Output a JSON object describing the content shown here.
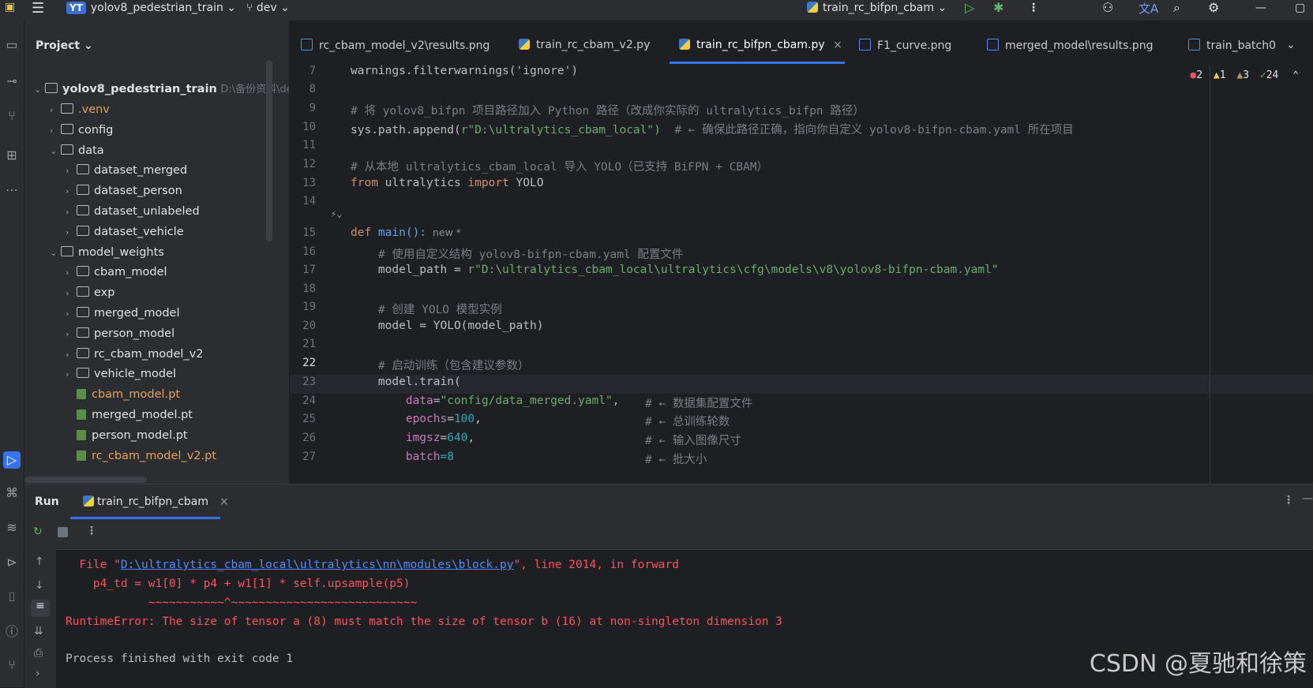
{
  "titlebar": {
    "project_badge": "YT",
    "project_name": "yolov8_pedestrian_train",
    "branch": "dev",
    "run_config": "train_rc_bifpn_cbam"
  },
  "project_panel": {
    "title": "Project",
    "root": "yolov8_pedestrian_train",
    "root_path": "D:\\备份资料\\dev",
    "items": [
      {
        "label": ".venv",
        "type": "folder",
        "indent": 1,
        "expanded": false
      },
      {
        "label": "config",
        "type": "folder",
        "indent": 1,
        "expanded": false
      },
      {
        "label": "data",
        "type": "folder",
        "indent": 1,
        "expanded": true
      },
      {
        "label": "dataset_merged",
        "type": "folder",
        "indent": 2,
        "expanded": false
      },
      {
        "label": "dataset_person",
        "type": "folder",
        "indent": 2,
        "expanded": false
      },
      {
        "label": "dataset_unlabeled",
        "type": "folder",
        "indent": 2,
        "expanded": false
      },
      {
        "label": "dataset_vehicle",
        "type": "folder",
        "indent": 2,
        "expanded": false
      },
      {
        "label": "model_weights",
        "type": "folder",
        "indent": 1,
        "expanded": true
      },
      {
        "label": "cbam_model",
        "type": "folder",
        "indent": 2,
        "expanded": false
      },
      {
        "label": "exp",
        "type": "folder",
        "indent": 2,
        "expanded": false
      },
      {
        "label": "merged_model",
        "type": "folder",
        "indent": 2,
        "expanded": false
      },
      {
        "label": "person_model",
        "type": "folder",
        "indent": 2,
        "expanded": false
      },
      {
        "label": "rc_cbam_model_v2",
        "type": "folder",
        "indent": 2,
        "expanded": false
      },
      {
        "label": "vehicle_model",
        "type": "folder",
        "indent": 2,
        "expanded": false
      },
      {
        "label": "cbam_model.pt",
        "type": "file",
        "indent": 2,
        "status": "orange"
      },
      {
        "label": "merged_model.pt",
        "type": "file",
        "indent": 2,
        "status": "normal"
      },
      {
        "label": "person_model.pt",
        "type": "file",
        "indent": 2,
        "status": "normal"
      },
      {
        "label": "rc_cbam_model_v2.pt",
        "type": "file",
        "indent": 2,
        "status": "orange"
      }
    ]
  },
  "tabs": [
    {
      "label": "rc_cbam_model_v2\\results.png",
      "kind": "image"
    },
    {
      "label": "train_rc_cbam_v2.py",
      "kind": "python"
    },
    {
      "label": "train_rc_bifpn_cbam.py",
      "kind": "python",
      "active": true
    },
    {
      "label": "F1_curve.png",
      "kind": "image"
    },
    {
      "label": "merged_model\\results.png",
      "kind": "image"
    },
    {
      "label": "train_batch0",
      "kind": "image"
    }
  ],
  "inspections": {
    "errors": "2",
    "warnings": "1",
    "weak_warnings": "3",
    "ok": "24"
  },
  "editor": {
    "lines": [
      "7",
      "8",
      "9",
      "10",
      "11",
      "12",
      "13",
      "14",
      "15",
      "16",
      "17",
      "18",
      "19",
      "20",
      "21",
      "22",
      "23",
      "24",
      "25",
      "26",
      "27"
    ],
    "code_7": "warnings.filterwarnings('ignore')",
    "c9": "# 将 yolov8_bifpn 项目路径加入 Python 路径（改成你实际的 ultralytics_bifpn 路径）",
    "c10a": "sys.path.append(",
    "c10b": "r\"D:\\ultralytics_cbam_local\")",
    "c10c": "  # ← 确保此路径正确，指向你自定义 yolov8-bifpn-cbam.yaml 所在项目",
    "c12": "# 从本地 ultralytics_cbam_local 导入 YOLO（已支持 BiFPN + CBAM）",
    "c13a": "from",
    "c13b": " ultralytics ",
    "c13c": "import",
    "c13d": " YOLO",
    "c15a": "def",
    "c15b": " main():",
    "c15c": "  new *",
    "c16": "    # 使用自定义结构 yolov8-bifpn-cbam.yaml 配置文件",
    "c17a": "    model_path = ",
    "c17b": "r\"D:\\ultralytics_cbam_local\\ultralytics\\cfg\\models\\v8\\yolov8-bifpn-cbam.yaml\"",
    "c19": "    # 创建 YOLO 模型实例",
    "c20": "    model = YOLO(model_path)",
    "c22": "    # 启动训练（包含建议参数）",
    "c23": "    model.train(",
    "c24a": "        data",
    "c24b": "=",
    "c24c": "\"config/data_merged.yaml\"",
    "c24d": ",",
    "c24e": "# ← 数据集配置文件",
    "c25a": "        epochs",
    "c25b": "=",
    "c25c": "100",
    "c25d": ",",
    "c25e": "# ← 总训练轮数",
    "c26a": "        imgsz",
    "c26b": "=",
    "c26c": "640",
    "c26d": ",",
    "c26e": "# ← 输入图像尺寸",
    "c27a": "        batch",
    "c27b": "=8",
    "c27e": "# ← 批大小"
  },
  "run_panel": {
    "title": "Run",
    "tab": "train_rc_bifpn_cbam",
    "line1a": "  File \"",
    "line1_link": "D:\\ultralytics_cbam_local\\ultralytics\\nn\\modules\\block.py",
    "line1b": "\", line 2014, in forward",
    "line2": "    p4_td = w1[0] * p4 + w1[1] * self.upsample(p5)",
    "line3": "            ~~~~~~~~~~~^~~~~~~~~~~~~~~~~~~~~~~~~~~~",
    "line4": "RuntimeError: The size of tensor a (8) must match the size of tensor b (16) at non-singleton dimension 3",
    "line5": "Process finished with exit code 1"
  },
  "watermark": "CSDN @夏驰和徐策"
}
